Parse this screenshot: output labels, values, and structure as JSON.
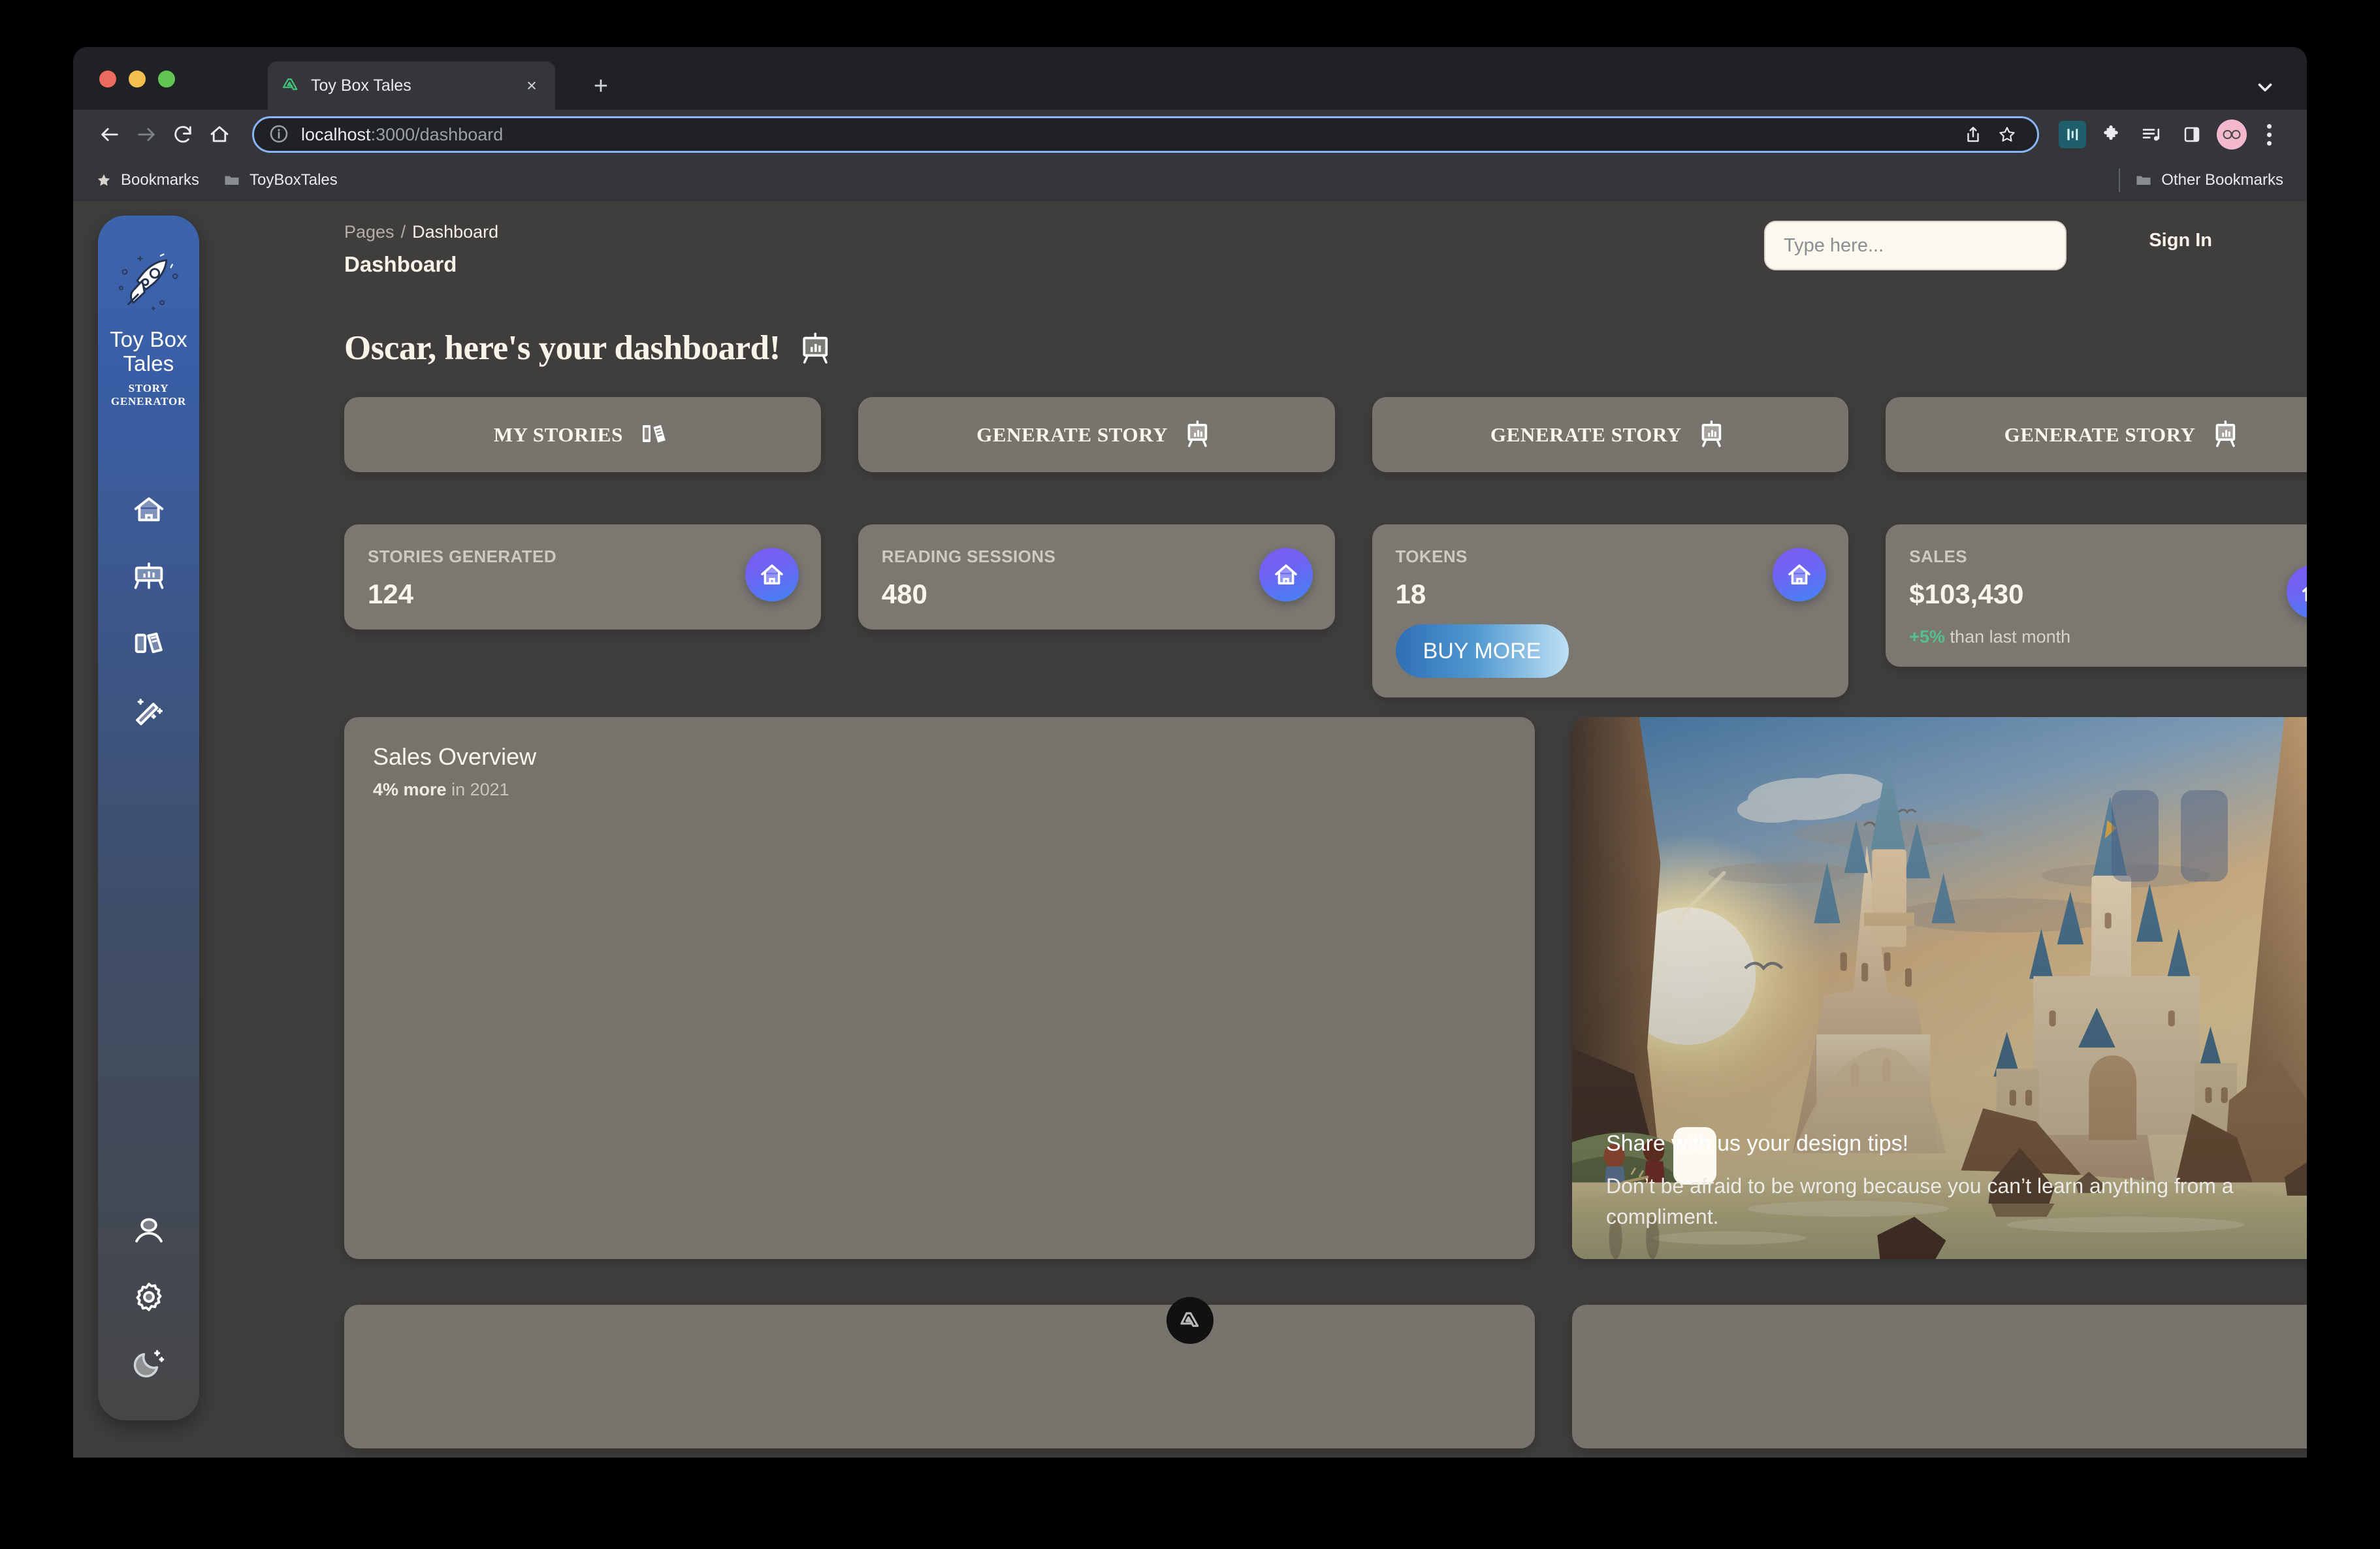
{
  "browser": {
    "tab": {
      "title": "Toy Box Tales",
      "favicon": "nuxt-logo-icon",
      "close": "×"
    },
    "newtab_label": "+",
    "address": {
      "scheme_host": "localhost",
      "rest": ":3000/dashboard"
    },
    "bookmarks": {
      "star_label": "Bookmarks",
      "folder_label": "ToyBoxTales",
      "other_label": "Other Bookmarks"
    }
  },
  "app": {
    "sidebar": {
      "brand_name": "Toy Box\nTales",
      "brand_line1": "Toy Box",
      "brand_line2": "Tales",
      "brand_sub_line1": "STORY",
      "brand_sub_line2": "GENERATOR",
      "logo": "rocket-icon",
      "items": [
        {
          "name": "home",
          "icon": "home-icon"
        },
        {
          "name": "dashboard",
          "icon": "presentation-chart-icon"
        },
        {
          "name": "stories",
          "icon": "books-icon"
        },
        {
          "name": "generate",
          "icon": "magic-wand-icon"
        }
      ],
      "bottom_items": [
        {
          "name": "profile",
          "icon": "user-icon"
        },
        {
          "name": "settings",
          "icon": "gear-icon"
        },
        {
          "name": "theme",
          "icon": "moon-icon"
        }
      ]
    },
    "header": {
      "breadcrumb_parent": "Pages",
      "breadcrumb_sep": "/",
      "breadcrumb_current": "Dashboard",
      "page_title": "Dashboard",
      "search_placeholder": "Type here...",
      "sign_in_label": "Sign In"
    },
    "greeting": {
      "text": "Oscar, here's your dashboard!",
      "icon": "presentation-chart-icon"
    },
    "actions": [
      {
        "label": "MY STORIES",
        "icon": "books-icon"
      },
      {
        "label": "GENERATE STORY",
        "icon": "presentation-chart-icon"
      },
      {
        "label": "GENERATE STORY",
        "icon": "presentation-chart-icon"
      },
      {
        "label": "GENERATE STORY",
        "icon": "presentation-chart-icon"
      }
    ],
    "stats": [
      {
        "key": "STORIES GENERATED",
        "value": "124",
        "icon": "home-icon"
      },
      {
        "key": "READING SESSIONS",
        "value": "480",
        "icon": "home-icon"
      },
      {
        "key": "TOKENS",
        "value": "18",
        "icon": "home-icon",
        "button": "BUY MORE"
      },
      {
        "key": "SALES",
        "value": "$103,430",
        "icon": "home-icon",
        "delta": "+5%",
        "delta_text": " than last month"
      }
    ],
    "sales_overview": {
      "title": "Sales Overview",
      "subtitle_strong": "4% more",
      "subtitle_rest": " in 2021"
    },
    "hero": {
      "heading": "Share with us your design tips!",
      "body": "Don’t be afraid to be wrong because you can’t learn anything from a compliment."
    },
    "footer_badge": "nuxt-logo-icon"
  },
  "colors": {
    "accent_purple": "#7a5cf0",
    "accent_blue": "#4285f4",
    "positive_green": "#55c08b",
    "card_bg": "#7b7872",
    "page_bg": "#403e3c",
    "sidebar_top": "#3c64ad",
    "cream": "#f9f5eb"
  }
}
